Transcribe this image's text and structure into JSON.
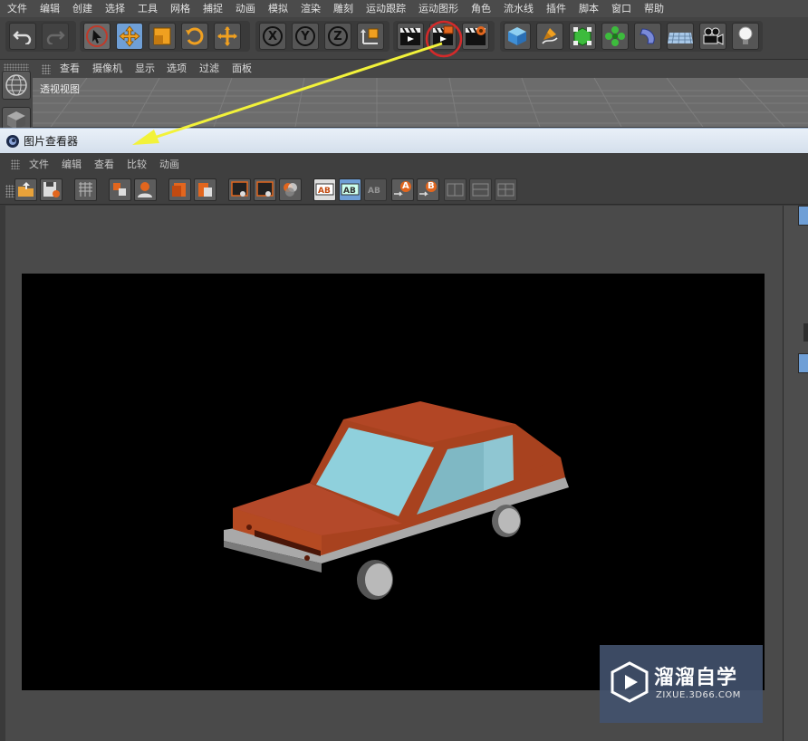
{
  "main_menu": [
    "文件",
    "编辑",
    "创建",
    "选择",
    "工具",
    "网格",
    "捕捉",
    "动画",
    "模拟",
    "渲染",
    "雕刻",
    "运动跟踪",
    "运动图形",
    "角色",
    "流水线",
    "插件",
    "脚本",
    "窗口",
    "帮助"
  ],
  "toolbar": {
    "axis_labels": [
      "X",
      "Y",
      "Z"
    ],
    "highlighted_tool": "render-to-picture-viewer-icon"
  },
  "viewport": {
    "menu": [
      "查看",
      "摄像机",
      "显示",
      "选项",
      "过滤",
      "面板"
    ],
    "label": "透视视图"
  },
  "picture_viewer": {
    "title": "图片查看器",
    "menu": [
      "文件",
      "编辑",
      "查看",
      "比较",
      "动画"
    ],
    "compare_labels": [
      "A",
      "B"
    ]
  },
  "watermark": {
    "brand": "溜溜自学",
    "url": "ZIXUE.3D66.COM"
  },
  "colors": {
    "car_body": "#a8421f",
    "car_glass": "#8fd0dc",
    "annotation_arrow": "#f2f23a",
    "highlight_circle": "#d42a2a"
  }
}
